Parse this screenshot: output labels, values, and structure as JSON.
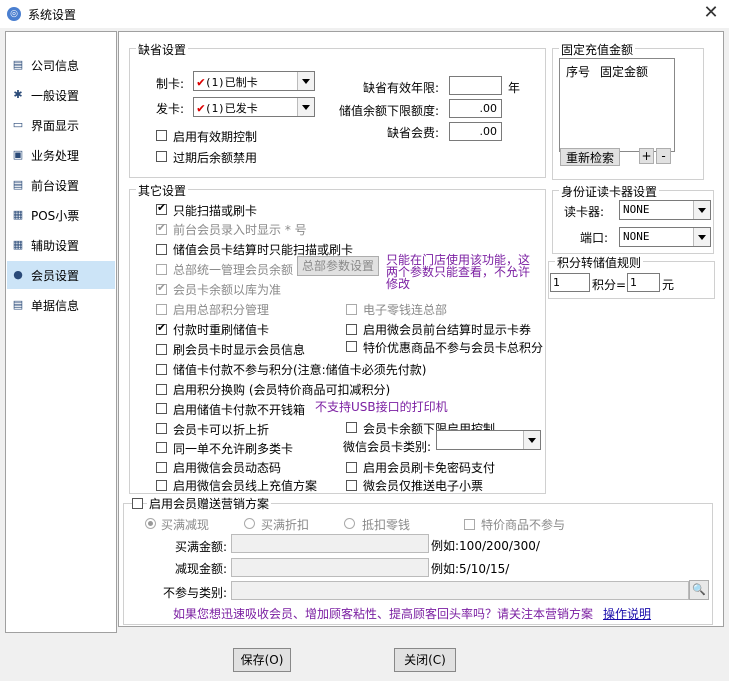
{
  "window": {
    "title": "系统设置",
    "close": "✕"
  },
  "sidebar": {
    "items": [
      {
        "label": "公司信息",
        "icon": "▤"
      },
      {
        "label": "一般设置",
        "icon": "✱"
      },
      {
        "label": "界面显示",
        "icon": "▭"
      },
      {
        "label": "业务处理",
        "icon": "▣"
      },
      {
        "label": "前台设置",
        "icon": "▤"
      },
      {
        "label": "POS小票",
        "icon": "▦"
      },
      {
        "label": "辅助设置",
        "icon": "▦"
      },
      {
        "label": "会员设置",
        "icon": "●"
      },
      {
        "label": "单据信息",
        "icon": "▤"
      }
    ],
    "selected": "会员设置"
  },
  "defaults": {
    "title": "缺省设置",
    "make_card_label": "制卡:",
    "make_card_value": "(1)已制卡",
    "issue_card_label": "发卡:",
    "issue_card_value": "(1)已发卡",
    "validity_label": "缺省有效年限:",
    "validity_value": "",
    "validity_unit": "年",
    "min_balance_label": "储值余额下限额度:",
    "min_balance_value": ".00",
    "fee_label": "缺省会费:",
    "fee_value": ".00",
    "enable_validity": "启用有效期控制",
    "disable_expired": "过期后余额禁用"
  },
  "fixed_recharge": {
    "title": "固定充值金额",
    "col_no": "序号",
    "col_amount": "固定金额",
    "refresh": "重新检索",
    "plus": "+",
    "minus": "-"
  },
  "id_reader": {
    "title": "身份证读卡器设置",
    "reader_label": "读卡器:",
    "reader_value": "NONE",
    "port_label": "端口:",
    "port_value": "NONE"
  },
  "points_rule": {
    "title": "积分转储值规则",
    "points_value": "1",
    "points_label": "积分=",
    "yuan_value": "1",
    "yuan_label": "元"
  },
  "other": {
    "title": "其它设置",
    "only_scan": "只能扫描或刷卡",
    "frontend_hide": "前台会员录入时显示 * 号",
    "stored_only_scan": "储值会员卡结算时只能扫描或刷卡",
    "hq_balance": "总部统一管理会员余额",
    "hq_params_btn": "总部参数设置",
    "hq_note": "只能在门店使用该功能，这两个参数只能查看，不允许修改",
    "balance_by_store": "会员卡余额以库为准",
    "hq_points": "启用总部积分管理",
    "change_hq": "电子零钱连总部",
    "refresh_on_pay": "付款时重刷储值卡",
    "wechat_coupon": "启用微会员前台结算时显示卡券",
    "show_info": "刷会员卡时显示会员信息",
    "special_no_points": "特价优惠商品不参与会员卡总积分",
    "stored_no_points": "储值卡付款不参与积分(注意:储值卡必须先付款)",
    "points_exchange": "启用积分换购 (会员特价商品可扣减积分)",
    "no_cashbox": "启用储值卡付款不开钱箱",
    "usb_note": "不支持USB接口的打印机",
    "discount_again": "会员卡可以折上折",
    "min_balance_ctrl": "会员卡余额下限启用控制",
    "no_multi_card": "同一单不允许刷多类卡",
    "wechat_type_label": "微信会员卡类别:",
    "wechat_type_value": "",
    "wechat_dynamic": "启用微信会员动态码",
    "no_pwd": "启用会员刷卡免密码支付",
    "wechat_online": "启用微信会员线上充值方案",
    "wechat_receipt": "微会员仅推送电子小票"
  },
  "promo": {
    "title": "启用会员赠送营销方案",
    "opt1": "买满减现",
    "opt2": "买满折扣",
    "opt3": "抵扣零钱",
    "special_excluded": "特价商品不参与",
    "amount_label": "买满金额:",
    "amount_example": "例如:100/200/300/",
    "reduce_label": "减现金额:",
    "reduce_example": "例如:5/10/15/",
    "exclude_label": "不参与类别:",
    "footer_text": "如果您想迅速吸收会员、增加顾客粘性、提高顾客回头率吗？请关注本营销方案",
    "help_link": "操作说明"
  },
  "buttons": {
    "save": "保存(O)",
    "close": "关闭(C)"
  }
}
